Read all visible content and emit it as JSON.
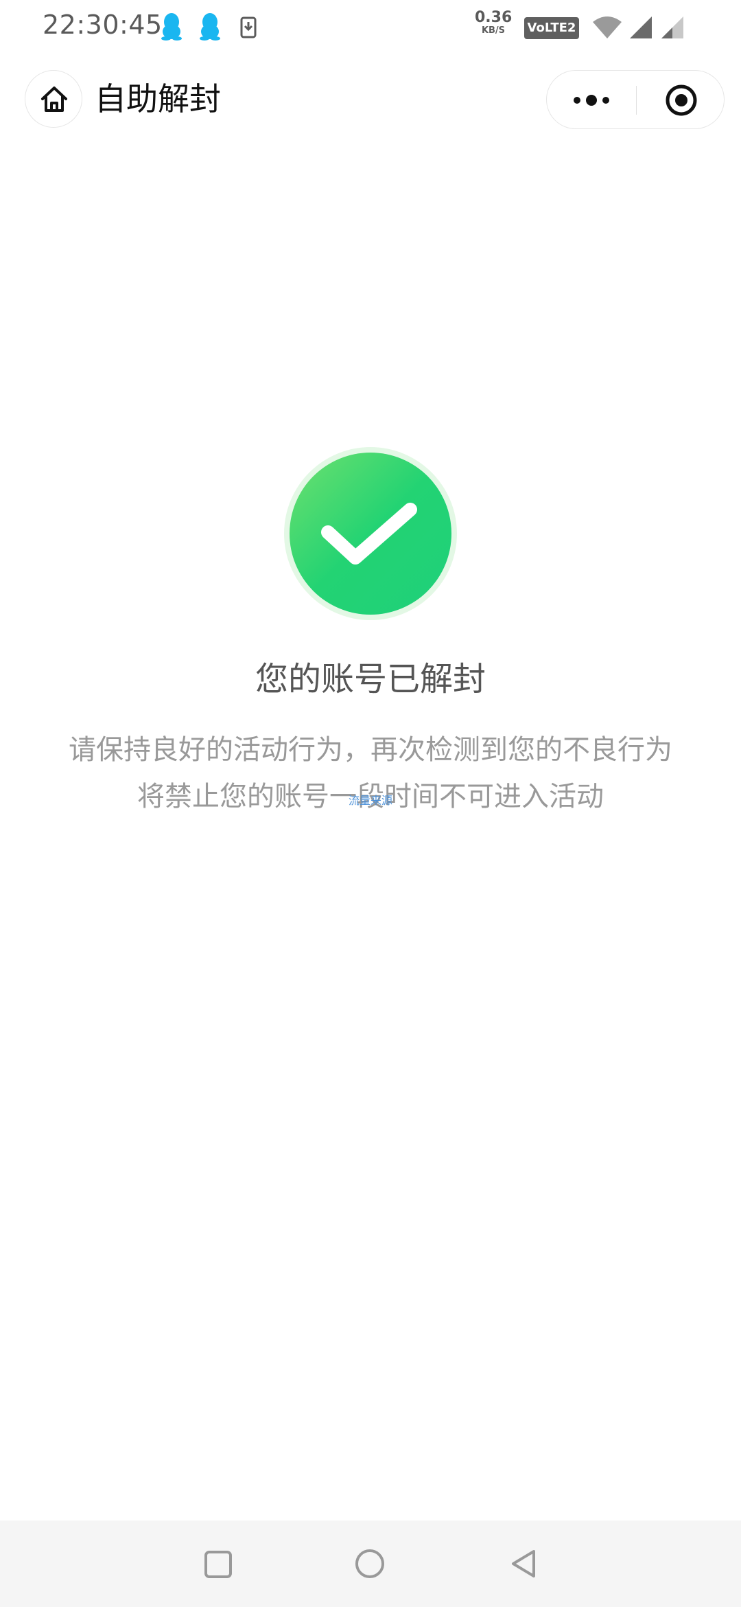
{
  "status_bar": {
    "time": "22:30:45",
    "net_speed_value": "0.36",
    "net_speed_unit": "KB/S",
    "volte_label": "VoLTE2",
    "icons": [
      "qq-icon",
      "qq-icon",
      "download-icon",
      "wifi-icon",
      "signal-icon",
      "signal-icon"
    ]
  },
  "title_bar": {
    "title": "自助解封",
    "home_icon": "home-icon",
    "more_icon": "more-dots-icon",
    "close_icon": "target-close-icon"
  },
  "result": {
    "icon": "success-check-icon",
    "title": "您的账号已解封",
    "desc_line1": "请保持良好的活动行为，再次检测到您的不良行为",
    "desc_line2": "将禁止您的账号一段时间不可进入活动",
    "overlay_text": "流量来源"
  },
  "nav_bar": {
    "icons": [
      "recent-apps-icon",
      "home-circle-icon",
      "back-triangle-icon"
    ]
  },
  "colors": {
    "success_green": "#23d373",
    "success_green_light": "#6ee06e",
    "title_text": "#555555",
    "desc_text": "#999999"
  }
}
